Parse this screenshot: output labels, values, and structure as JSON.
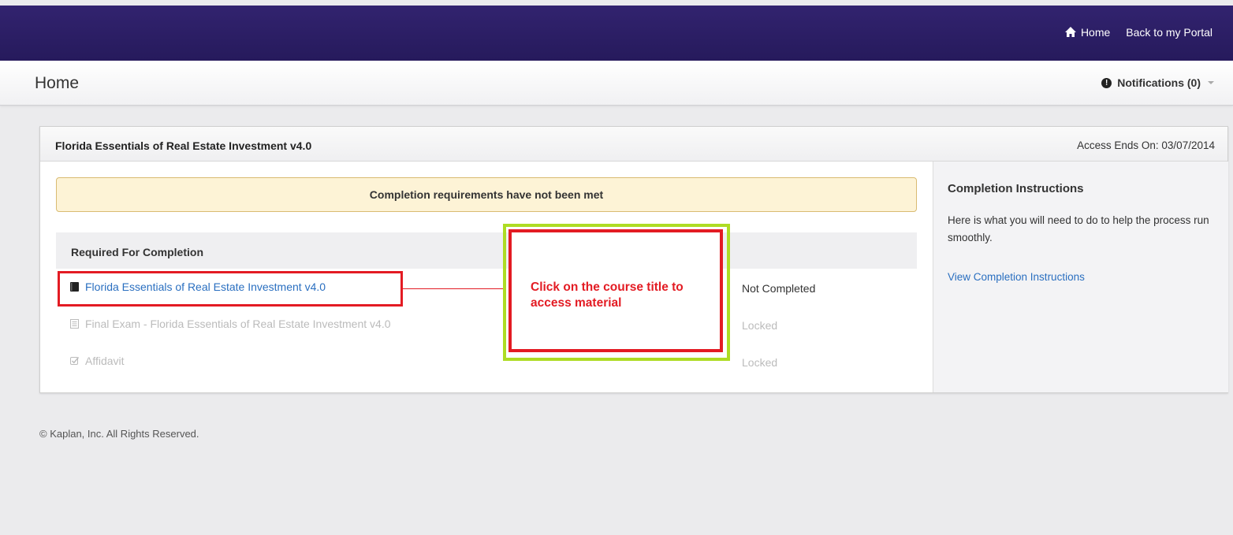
{
  "topnav": {
    "home_label": "Home",
    "portal_label": "Back to my Portal"
  },
  "header": {
    "page_title": "Home",
    "notifications_label": "Notifications (0)",
    "notifications_icon": "!"
  },
  "course": {
    "title": "Florida Essentials of Real Estate Investment v4.0",
    "access_ends": "Access Ends On: 03/07/2014",
    "alert": "Completion requirements have not been met",
    "required_header": "Required For Completion",
    "items": [
      {
        "label": "Florida Essentials of Real Estate Investment v4.0",
        "status": "Not Completed",
        "icon": "book-icon"
      },
      {
        "label": "Final Exam - Florida Essentials of Real Estate Investment v4.0",
        "status": "Locked",
        "icon": "document-icon"
      },
      {
        "label": "Affidavit",
        "status": "Locked",
        "icon": "checkbox-icon"
      }
    ]
  },
  "sidebar": {
    "title": "Completion Instructions",
    "text": "Here is what you will need to do to help the process run smoothly.",
    "link": "View Completion Instructions"
  },
  "annotation": {
    "text": "Click on the course title to access material"
  },
  "footer": {
    "copyright": "© Kaplan, Inc. All Rights Reserved."
  },
  "colors": {
    "topbar": "#2c1f67",
    "link": "#2a6fc0",
    "annotation_red": "#e31b23",
    "annotation_green": "#aedc24",
    "alert_bg": "#fdf3d6"
  }
}
